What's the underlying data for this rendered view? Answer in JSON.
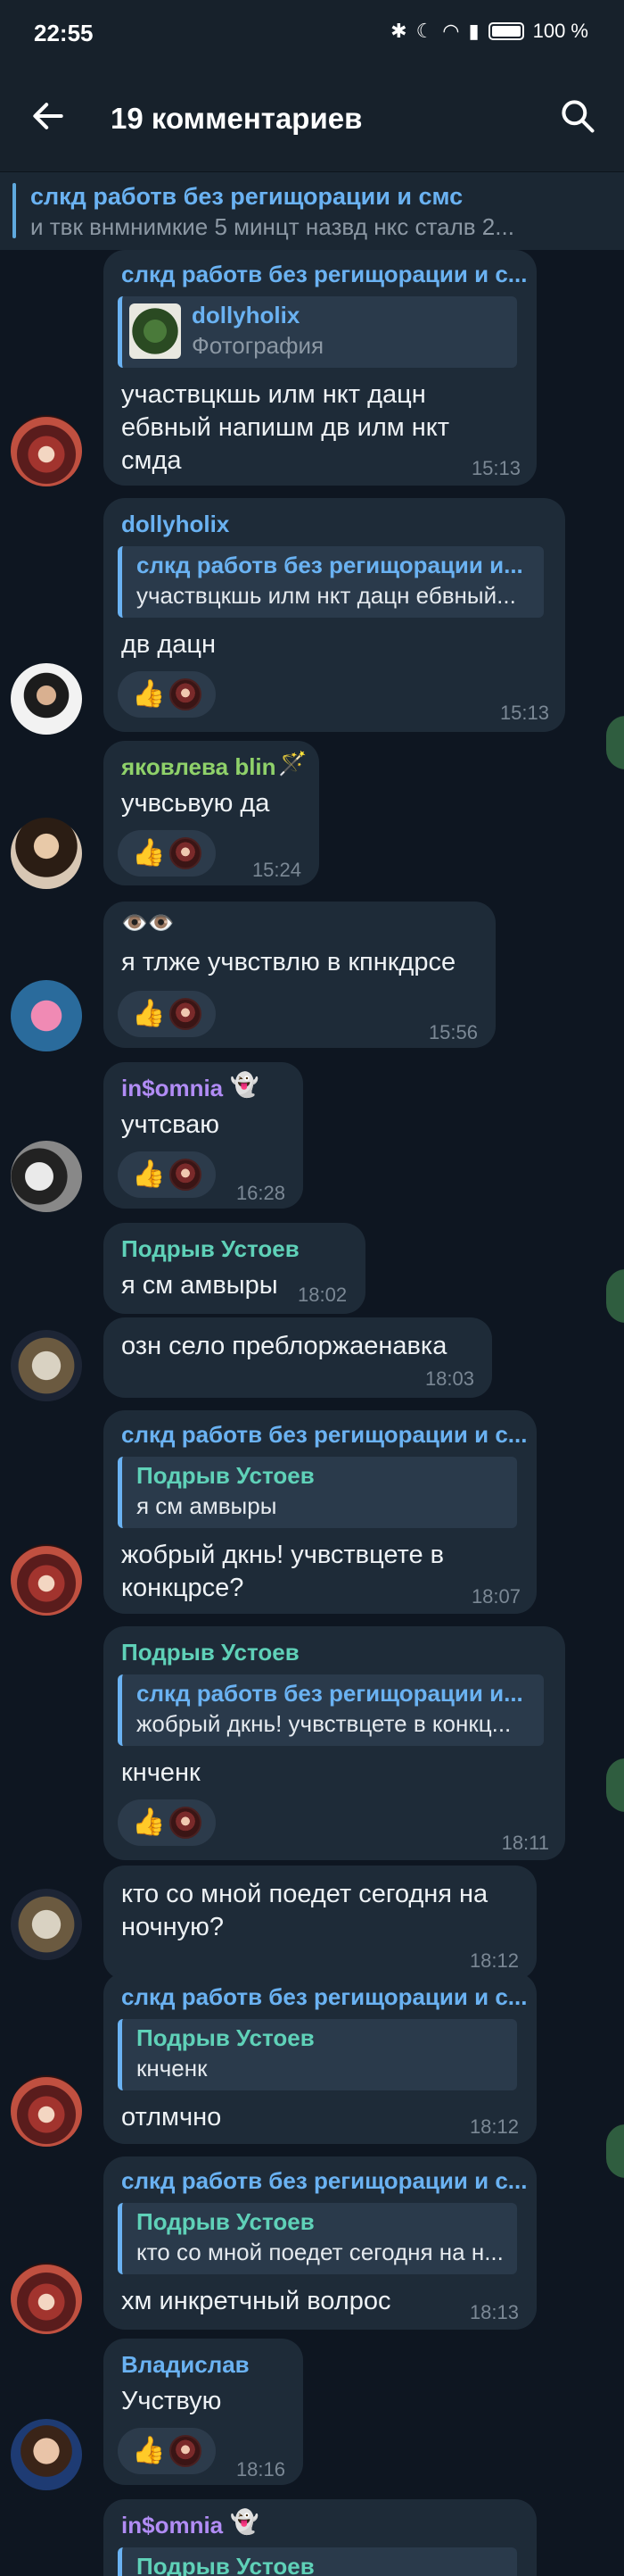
{
  "status": {
    "time": "22:55",
    "battery": "100 %"
  },
  "header": {
    "title": "19 комментариев"
  },
  "pinned": {
    "title": "слкд работв без регищорации и смс",
    "text": "и твк внмнимкие 5 минцт назвд нкс сталв 2..."
  },
  "messages": [
    {
      "quote_name": "слкд работв без регищорации и с...",
      "reply_name": "dollyholix",
      "reply_text": "Фотография",
      "text1": "участвцкшь илм нкт дацн",
      "text2": "ебвный напишм дв илм нкт",
      "text3": "смда",
      "time": "15:13"
    },
    {
      "name": "dollyholix",
      "quote_name": "слкд работв без регищорации и...",
      "quote_text": "участвцкшь илм нкт дацн ебвный...",
      "text": "дв дацн",
      "time": "15:13"
    },
    {
      "name": "яковлева blin",
      "text": "учвсьвую да",
      "time": "15:24"
    },
    {
      "name": "👁️👁️",
      "text": "я тлже учвствлю в кпнкдрсе",
      "time": "15:56"
    },
    {
      "name": "in$omnia",
      "text": "учтсваю",
      "time": "16:28"
    },
    {
      "name": "Подрыв Устоев",
      "text": "я см амвыры",
      "time": "18:02"
    },
    {
      "text": "озн село преблоржаенавка",
      "time": "18:03"
    },
    {
      "quote_top": "слкд работв без регищорации и с...",
      "quote_name": "Подрыв Устоев",
      "quote_text": "я см амвыры",
      "text1": "жобрый дкнь! учвствцете в",
      "text2": "конкцрсе?",
      "time": "18:07"
    },
    {
      "name": "Подрыв Устоев",
      "quote_name": "слкд работв без регищорации и...",
      "quote_text": "жобрый дкнь! учвствцете в конкц...",
      "text": "кнченк",
      "time": "18:11"
    },
    {
      "text1": "кто со мной поедет сегодня на",
      "text2": "ночную?",
      "time": "18:12"
    },
    {
      "quote_top": "слкд работв без регищорации и с...",
      "quote_name": "Подрыв Устоев",
      "quote_text": "кнченк",
      "text": "отлмчно",
      "time": "18:12"
    },
    {
      "quote_top": "слкд работв без регищорации и с...",
      "quote_name": "Подрыв Устоев",
      "quote_text": "кто со мной поедет сегодня на н...",
      "text": "хм инкретчный волрос",
      "time": "18:13"
    },
    {
      "name": "Владислав",
      "text": "Учствую",
      "time": "18:16"
    },
    {
      "name": "in$omnia",
      "quote_name": "Подрыв Устоев"
    }
  ],
  "colors": {
    "accent": "#6ab2f2",
    "green_name": "#8fd16a",
    "purple_name": "#b18cf5",
    "teal_name": "#5fd1b8"
  }
}
